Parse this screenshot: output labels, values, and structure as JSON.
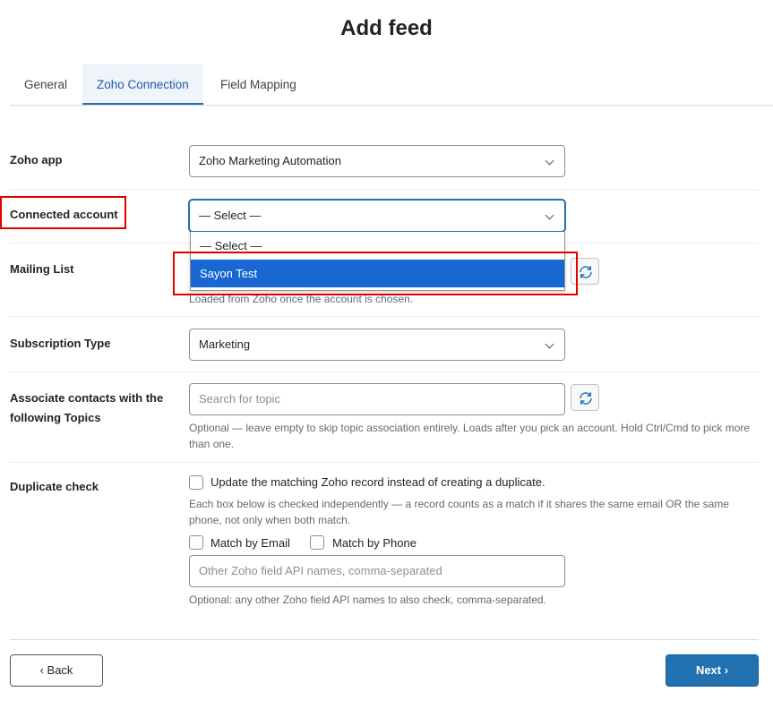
{
  "page": {
    "title": "Add feed"
  },
  "tabs": [
    {
      "label": "General"
    },
    {
      "label": "Zoho Connection"
    },
    {
      "label": "Field Mapping"
    }
  ],
  "form": {
    "zoho_app": {
      "label": "Zoho app",
      "value": "Zoho Marketing Automation"
    },
    "connected_account": {
      "label": "Connected account",
      "value": "— Select —",
      "options": [
        "— Select —",
        "Sayon Test"
      ],
      "highlighted_option": "Sayon Test"
    },
    "mailing_list": {
      "label": "Mailing List",
      "help": "Loaded from Zoho once the account is chosen."
    },
    "subscription_type": {
      "label": "Subscription Type",
      "value": "Marketing"
    },
    "topics": {
      "label_line1": "Associate contacts with the",
      "label_line2": "following Topics",
      "placeholder": "Search for topic",
      "help": "Optional — leave empty to skip topic association entirely. Loads after you pick an account. Hold Ctrl/Cmd to pick more than one."
    },
    "duplicate_check": {
      "label": "Duplicate check",
      "update_label": "Update the matching Zoho record instead of creating a duplicate.",
      "help": "Each box below is checked independently — a record counts as a match if it shares the same email OR the same phone, not only when both match.",
      "match_email_label": "Match by Email",
      "match_phone_label": "Match by Phone",
      "other_fields_placeholder": "Other Zoho field API names, comma-separated",
      "other_fields_help": "Optional: any other Zoho field API names to also check, comma-separated."
    }
  },
  "footer": {
    "back_label": "‹ Back",
    "next_label": "Next ›"
  },
  "colors": {
    "accent": "#2271b1",
    "highlight": "#1967d2",
    "annotation": "#e00000"
  }
}
